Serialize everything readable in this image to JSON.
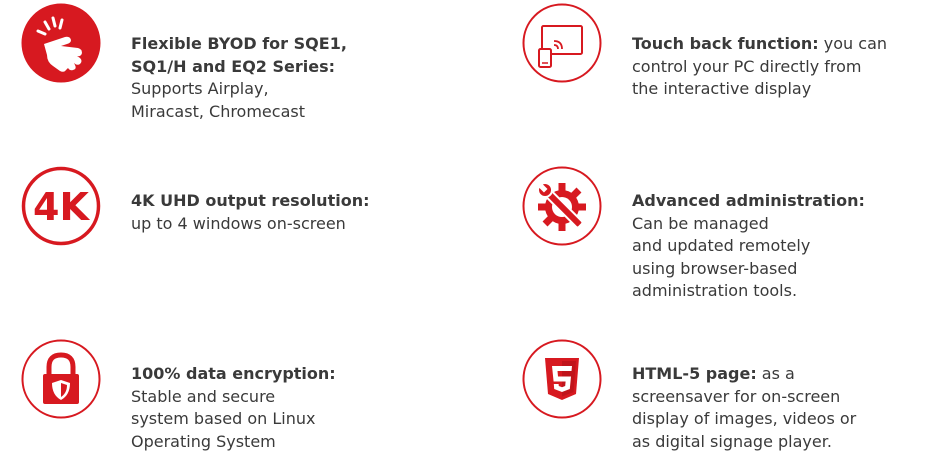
{
  "accent_color": "#d71920",
  "features": {
    "byod": {
      "icon": "hand-snap-icon",
      "title_lines": [
        "Flexible BYOD for SQE1,",
        "SQ1/H and EQ2 Series:"
      ],
      "body_lines": [
        "Supports Airplay,",
        "Miracast, Chromecast"
      ]
    },
    "touchback": {
      "icon": "display-with-tablet-icon",
      "title": "Touch back function:",
      "first_line_rest": " you can",
      "body_lines": [
        "control your PC directly from",
        "the interactive display"
      ]
    },
    "uhd": {
      "icon": "4k-icon",
      "icon_text": "4K",
      "title": "4K UHD output resolution:",
      "body_lines": [
        "up to 4 windows on-screen"
      ]
    },
    "admin": {
      "icon": "gear-wrench-icon",
      "title": "Advanced administration:",
      "body_lines": [
        "Can be managed",
        "and updated remotely",
        "using browser-based",
        "administration tools."
      ]
    },
    "encryption": {
      "icon": "padlock-shield-icon",
      "title": "100% data encryption:",
      "body_lines": [
        "Stable and secure",
        "system based on Linux",
        "Operating System"
      ]
    },
    "html5": {
      "icon": "html5-icon",
      "title": "HTML-5 page:",
      "first_line_rest": " as a",
      "body_lines": [
        "screensaver for on-screen",
        "display of images, videos or",
        "as digital signage player."
      ]
    }
  }
}
